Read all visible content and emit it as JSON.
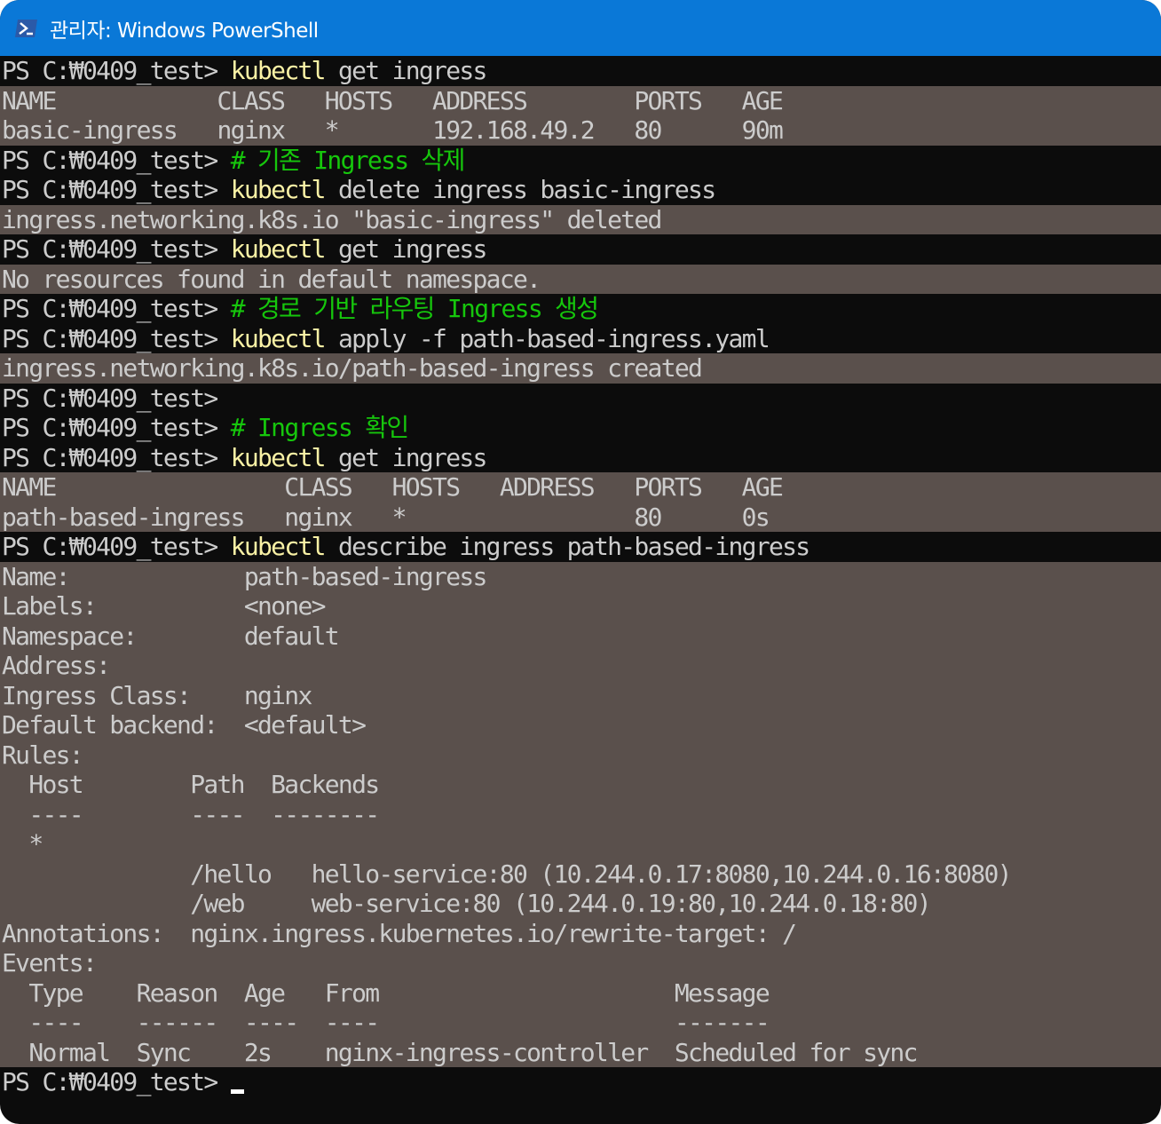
{
  "window": {
    "title": "관리자: Windows PowerShell"
  },
  "colors": {
    "titlebar": "#0a78d7",
    "terminal_bg": "#0c0c0c",
    "output_bg": "#5a504c",
    "text": "#cccccc",
    "command": "#f9f1a5",
    "comment": "#16c60c"
  },
  "prompt": "PS C:₩0409_test> ",
  "lines": [
    {
      "type": "prompt",
      "cmd": "kubectl",
      "rest": " get ingress"
    },
    {
      "type": "out",
      "text": "NAME            CLASS   HOSTS   ADDRESS        PORTS   AGE"
    },
    {
      "type": "out",
      "text": "basic-ingress   nginx   *       192.168.49.2   80      90m"
    },
    {
      "type": "prompt",
      "comment": "# 기존 Ingress 삭제"
    },
    {
      "type": "prompt",
      "cmd": "kubectl",
      "rest": " delete ingress basic-ingress"
    },
    {
      "type": "out",
      "text": "ingress.networking.k8s.io \"basic-ingress\" deleted"
    },
    {
      "type": "prompt",
      "cmd": "kubectl",
      "rest": " get ingress"
    },
    {
      "type": "out",
      "text": "No resources found in default namespace."
    },
    {
      "type": "prompt",
      "comment": "# 경로 기반 라우팅 Ingress 생성"
    },
    {
      "type": "prompt",
      "cmd": "kubectl",
      "rest": " apply -f path-based-ingress.yaml"
    },
    {
      "type": "out",
      "text": "ingress.networking.k8s.io/path-based-ingress created"
    },
    {
      "type": "prompt"
    },
    {
      "type": "prompt",
      "comment": "# Ingress 확인"
    },
    {
      "type": "prompt",
      "cmd": "kubectl",
      "rest": " get ingress"
    },
    {
      "type": "out",
      "text": "NAME                 CLASS   HOSTS   ADDRESS   PORTS   AGE"
    },
    {
      "type": "out",
      "text": "path-based-ingress   nginx   *                 80      0s"
    },
    {
      "type": "prompt",
      "cmd": "kubectl",
      "rest": " describe ingress path-based-ingress"
    },
    {
      "type": "out",
      "text": "Name:             path-based-ingress"
    },
    {
      "type": "out",
      "text": "Labels:           <none>"
    },
    {
      "type": "out",
      "text": "Namespace:        default"
    },
    {
      "type": "out",
      "text": "Address:"
    },
    {
      "type": "out",
      "text": "Ingress Class:    nginx"
    },
    {
      "type": "out",
      "text": "Default backend:  <default>"
    },
    {
      "type": "out",
      "text": "Rules:"
    },
    {
      "type": "out",
      "text": "  Host        Path  Backends"
    },
    {
      "type": "out",
      "text": "  ----        ----  --------"
    },
    {
      "type": "out",
      "text": "  *"
    },
    {
      "type": "out",
      "text": "              /hello   hello-service:80 (10.244.0.17:8080,10.244.0.16:8080)"
    },
    {
      "type": "out",
      "text": "              /web     web-service:80 (10.244.0.19:80,10.244.0.18:80)"
    },
    {
      "type": "out",
      "text": "Annotations:  nginx.ingress.kubernetes.io/rewrite-target: /"
    },
    {
      "type": "out",
      "text": "Events:"
    },
    {
      "type": "out",
      "text": "  Type    Reason  Age   From                      Message"
    },
    {
      "type": "out",
      "text": "  ----    ------  ----  ----                      -------"
    },
    {
      "type": "out",
      "text": "  Normal  Sync    2s    nginx-ingress-controller  Scheduled for sync"
    },
    {
      "type": "prompt",
      "cursor": true
    }
  ]
}
